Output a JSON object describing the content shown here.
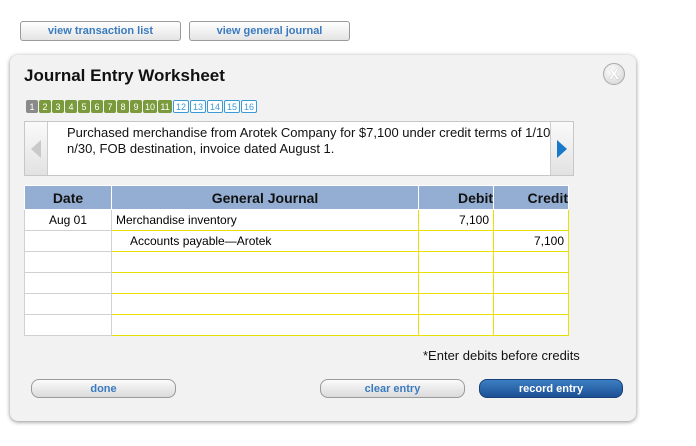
{
  "top_buttons": {
    "transaction_list": "view transaction list",
    "general_journal": "view general journal"
  },
  "panel": {
    "title": "Journal Entry Worksheet",
    "close_glyph": "X",
    "steps": [
      "1",
      "2",
      "3",
      "4",
      "5",
      "6",
      "7",
      "8",
      "9",
      "10",
      "11",
      "12",
      "13",
      "14",
      "15",
      "16"
    ],
    "current_step": "1",
    "completed_through": "11",
    "description": "Purchased merchandise from Arotek Company for $7,100 under credit terms of 1/10, n/30, FOB destination, invoice dated August 1."
  },
  "table": {
    "headers": {
      "date": "Date",
      "account": "General Journal",
      "debit": "Debit",
      "credit": "Credit"
    },
    "rows": [
      {
        "date": "Aug 01",
        "account": "Merchandise inventory",
        "debit": "7,100",
        "credit": ""
      },
      {
        "date": "",
        "account": "Accounts payable—Arotek",
        "debit": "",
        "credit": "7,100"
      },
      {
        "date": "",
        "account": "",
        "debit": "",
        "credit": ""
      },
      {
        "date": "",
        "account": "",
        "debit": "",
        "credit": ""
      },
      {
        "date": "",
        "account": "",
        "debit": "",
        "credit": ""
      },
      {
        "date": "",
        "account": "",
        "debit": "",
        "credit": ""
      }
    ]
  },
  "note": "*Enter debits before credits",
  "buttons": {
    "done": "done",
    "clear_entry": "clear entry",
    "record_entry": "record entry"
  },
  "colors": {
    "header_bg": "#93aed2",
    "step_done": "#7a9a3c",
    "step_todo": "#3a9ad9",
    "record_button": "#1c4f94"
  },
  "icons": {
    "close": "close-icon",
    "prev": "arrow-left-icon",
    "next": "arrow-right-icon"
  }
}
